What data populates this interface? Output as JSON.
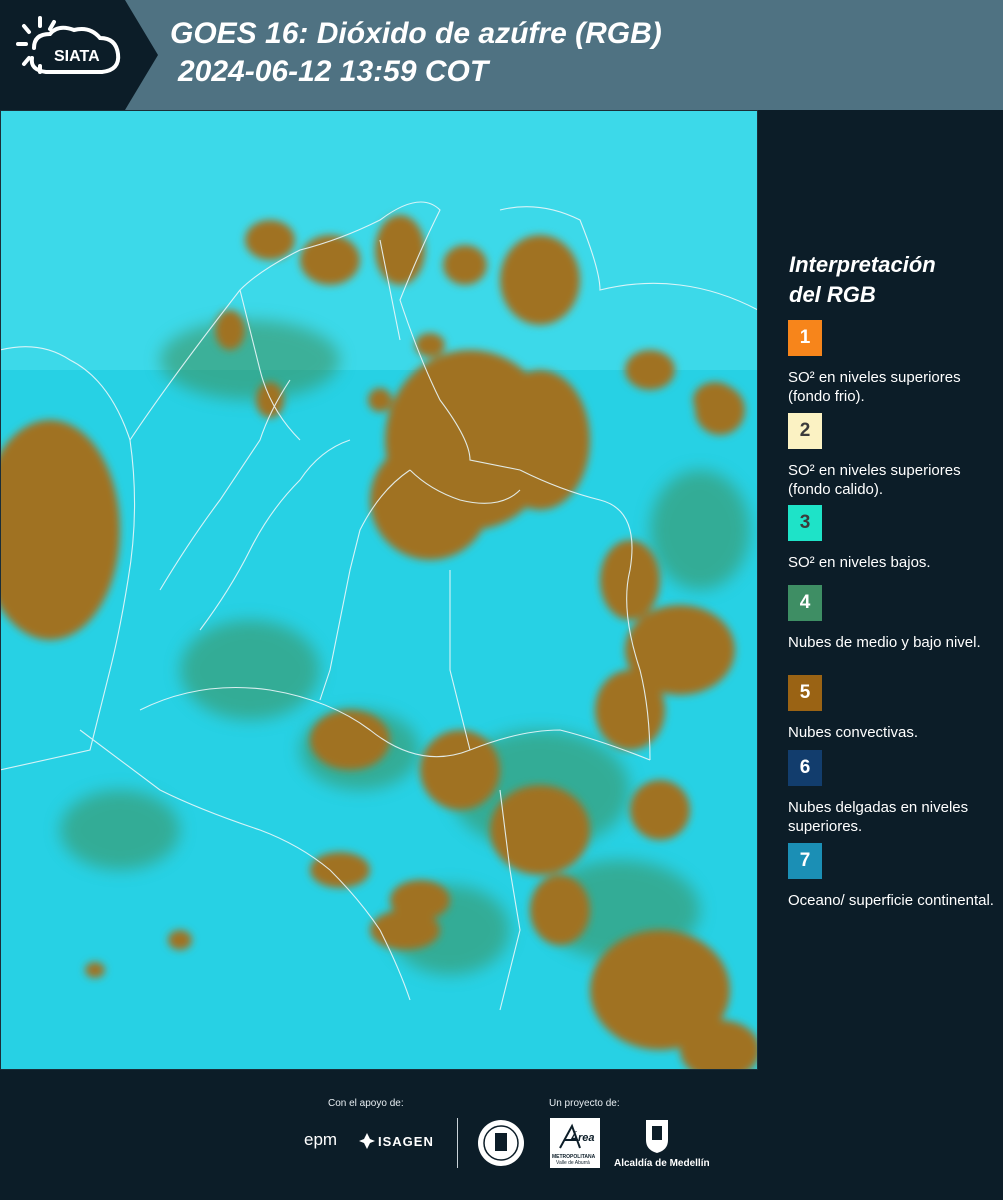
{
  "header": {
    "logo_text": "SIATA",
    "title": "GOES 16: Dióxido de azúfre (RGB)",
    "datetime": "2024-06-12 13:59 COT"
  },
  "map": {
    "description_icon": "satellite-rgb-map",
    "colors": {
      "ocean": "#27d1e4",
      "cloud_orange": "#a07224",
      "cloud_green": "#3d8f58",
      "border": "#e8f4f8"
    }
  },
  "legend": {
    "title_line1": "Interpretación",
    "title_line2": "del RGB",
    "items": [
      {
        "number": "1",
        "color": "#f7851b",
        "text": "SO² en niveles superiores (fondo frio)."
      },
      {
        "number": "2",
        "color": "#fbf2c3",
        "text": "SO² en niveles superiores (fondo calido)."
      },
      {
        "number": "3",
        "color": "#1ee3c8",
        "text": "SO² en niveles bajos."
      },
      {
        "number": "4",
        "color": "#3e8e64",
        "text": "Nubes de medio y bajo nivel."
      },
      {
        "number": "5",
        "color": "#9a6314",
        "text": "Nubes convectivas."
      },
      {
        "number": "6",
        "color": "#123d6d",
        "text": "Nubes delgadas en niveles superiores."
      },
      {
        "number": "7",
        "color": "#1b8fb5",
        "text": "Oceano/ superficie continental."
      }
    ]
  },
  "footer": {
    "support_label": "Con el apoyo de:",
    "project_label": "Un proyecto de:",
    "sponsor1": "epm",
    "sponsor2": "ISAGEN",
    "partner_metro": "Área",
    "partner_metro_sub": "METROPOLITANA",
    "partner_metro_sub2": "Valle de Aburrá",
    "partner_alcaldia": "Alcaldía de Medellín"
  }
}
